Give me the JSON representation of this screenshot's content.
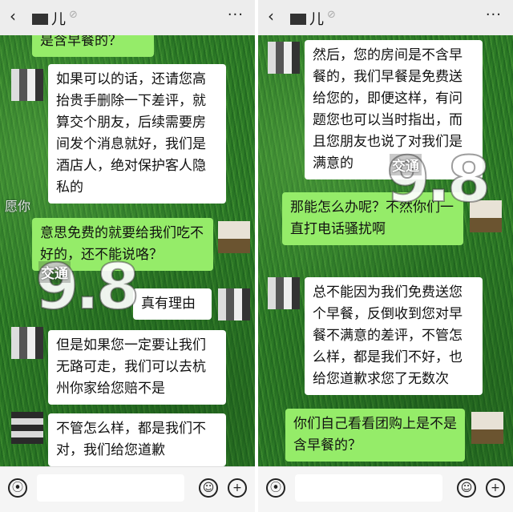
{
  "left": {
    "header": {
      "back_icon": "chevron-left-icon",
      "title": "儿",
      "mute_icon": "bell-mute-icon",
      "more": "···"
    },
    "messages": [
      {
        "side": "out",
        "text": "是含早餐的？"
      },
      {
        "side": "in",
        "text": "如果可以的话，还请您高抬贵手删除一下差评，就算交个朋友，后续需要房间发个消息就好，我们是酒店人，绝对保护客人隐私的"
      },
      {
        "side": "out",
        "text": "意思免费的就要给我们吃不好的，还不能说咯？"
      },
      {
        "side": "in",
        "text": "真有理由"
      },
      {
        "side": "in",
        "text": "但是如果您一定要让我们无路可走，我们可以去杭州你家给您赔不是"
      },
      {
        "side": "in",
        "text": "不管怎么样，都是我们不对，我们给您道歉"
      }
    ],
    "background_text": "愿你"
  },
  "right": {
    "header": {
      "back_icon": "chevron-left-icon",
      "title": "儿",
      "mute_icon": "bell-mute-icon",
      "more": "···"
    },
    "messages": [
      {
        "side": "in",
        "text": "然后，您的房间是不含早餐的，我们早餐是免费送给您的，即便这样，有问题您也可以当时指出，而且您朋友也说了对我们是满意的"
      },
      {
        "side": "out",
        "text": "那能怎么办呢？不然你们一直打电话骚扰啊"
      },
      {
        "side": "in",
        "text": "总不能因为我们免费送您个早餐，反倒收到您对早餐不满意的差评，不管怎么样，都是我们不好，也给您道歉求您了无数次"
      },
      {
        "side": "out",
        "text": "你们自己看看团购上是不是含早餐的？"
      }
    ]
  },
  "watermark": {
    "tag": "交通",
    "number": "9.8"
  },
  "footer": {
    "voice_icon": "voice-icon",
    "emoji_icon": "emoji-icon",
    "plus_icon": "plus-icon"
  }
}
